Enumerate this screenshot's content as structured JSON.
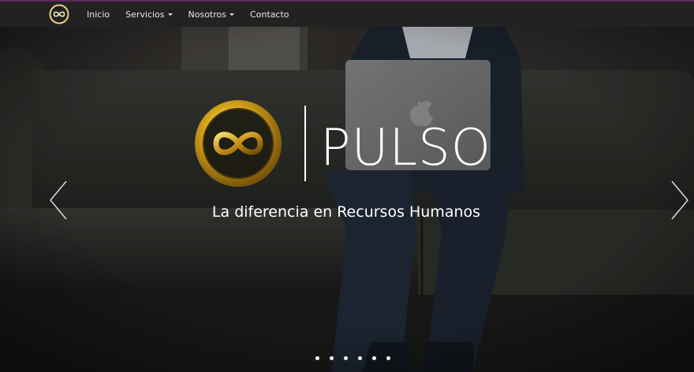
{
  "navbar": {
    "logo_icon": "infinity-icon",
    "items": [
      {
        "label": "Inicio",
        "has_caret": false
      },
      {
        "label": "Servicios",
        "has_caret": true
      },
      {
        "label": "Nosotros",
        "has_caret": true
      },
      {
        "label": "Contacto",
        "has_caret": false
      }
    ],
    "accent_color": "#5a2a5e",
    "background_color": "#222222"
  },
  "hero": {
    "brand_name": "PULSO",
    "tagline": "La diferencia en Recursos Humanos",
    "logo_icon": "gold-infinity-ring-icon",
    "logo_color": "#d4a017",
    "prev_icon": "chevron-left-icon",
    "next_icon": "chevron-right-icon",
    "slide_count": 6
  }
}
